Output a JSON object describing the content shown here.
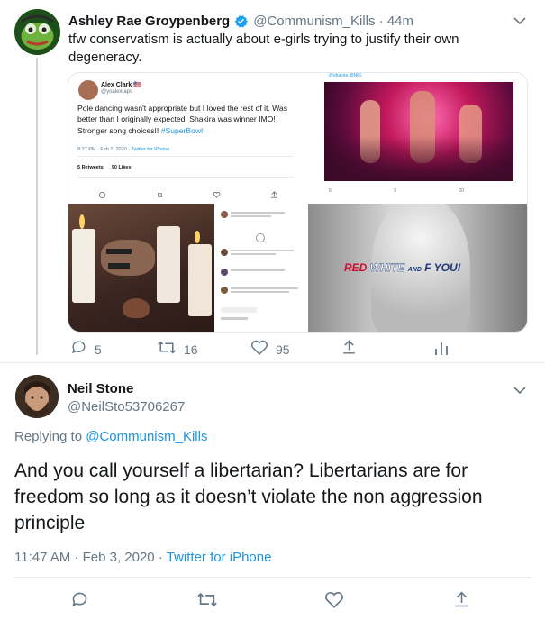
{
  "first_tweet": {
    "author_name": "Ashley Rae Groypenberg",
    "handle_time": "@Communism_Kills · 44m",
    "text": "tfw conservatism is actually about e-girls trying to justify their own degeneracy.",
    "actions": {
      "replies": "5",
      "retweets": "16",
      "likes": "95"
    }
  },
  "embedded": {
    "name": "Alex Clark 🇺🇸",
    "handle": "@yoalexrapc",
    "text_main": "Pole dancing wasn't appropriate but I loved the rest of it. Was better than I originally expected. Shakira was winner IMO! Stronger song choices!!",
    "hashtag": "#SuperBowl",
    "meta_time": "8:27 PM · Feb 2, 2020 ·",
    "meta_source": "Twitter for iPhone",
    "retweets_text": "5 Retweets",
    "likes_text": "90 Likes",
    "flag_text_red": "RED",
    "flag_text_white": "WHITE",
    "flag_text_and": "AND",
    "flag_text_fyou": "F YOU!",
    "top_right_handle": "@shakira @NFL",
    "tr_counts": {
      "replies": "6",
      "retweets": "9",
      "likes": "20"
    }
  },
  "reply": {
    "author_name": "Neil Stone",
    "handle": "@NeilSto53706267",
    "replying_prefix": "Replying to",
    "replying_to": "@Communism_Kills",
    "text": "And you call yourself a libertarian? Libertarians are for freedom so long as it doesn’t violate the non aggression principle",
    "time": "11:47 AM · Feb 3, 2020 ·",
    "source": "Twitter for iPhone"
  },
  "colors": {
    "accent": "#1b95e0",
    "muted": "#657786",
    "verified": "#1da1f2",
    "border": "#e1e8ed"
  }
}
